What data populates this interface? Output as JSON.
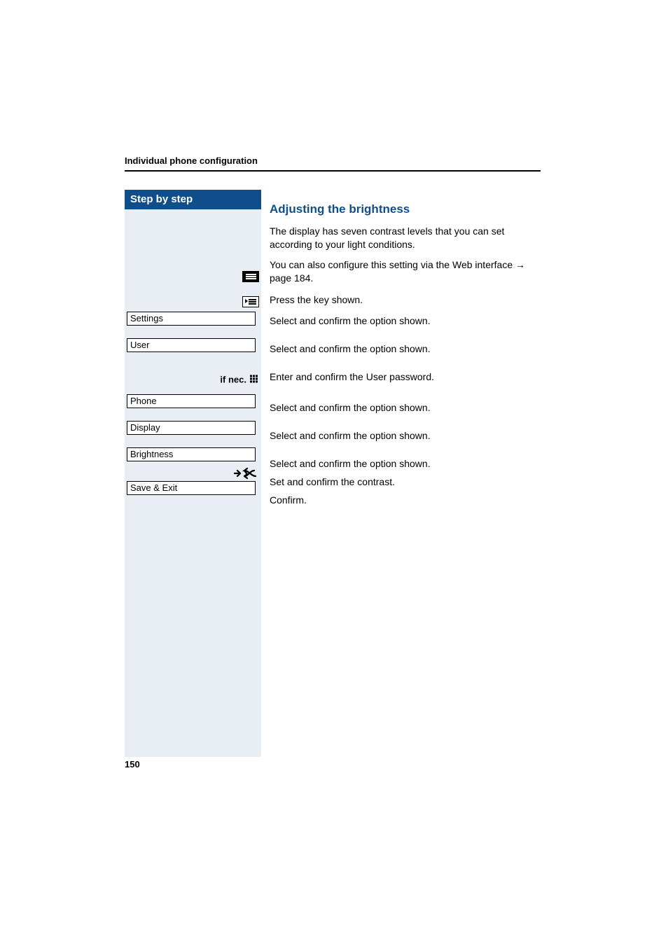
{
  "header": {
    "section_title": "Individual phone configuration"
  },
  "sidebar": {
    "title": "Step by step",
    "if_nec_label": "if nec.",
    "menu_items": {
      "settings": "Settings",
      "user": "User",
      "phone": "Phone",
      "display": "Display",
      "brightness": "Brightness",
      "save_exit": "Save & Exit"
    }
  },
  "content": {
    "heading": "Adjusting the brightness",
    "intro": "The display has seven contrast levels that you can set according to your light conditions.",
    "web_note_pre": "You can also configure this setting via the Web interface ",
    "web_note_arrow": "→",
    "web_note_post": " page 184.",
    "steps": {
      "press_key": "Press the key shown.",
      "settings": "Select and confirm the option shown.",
      "user": "Select and confirm the option shown.",
      "password": "Enter and confirm the User password.",
      "phone": "Select and confirm the option shown.",
      "display": "Select and confirm the option shown.",
      "brightness": "Select and confirm the option shown.",
      "set_contrast": "Set and confirm the contrast.",
      "confirm": "Confirm."
    }
  },
  "page_number": "150"
}
